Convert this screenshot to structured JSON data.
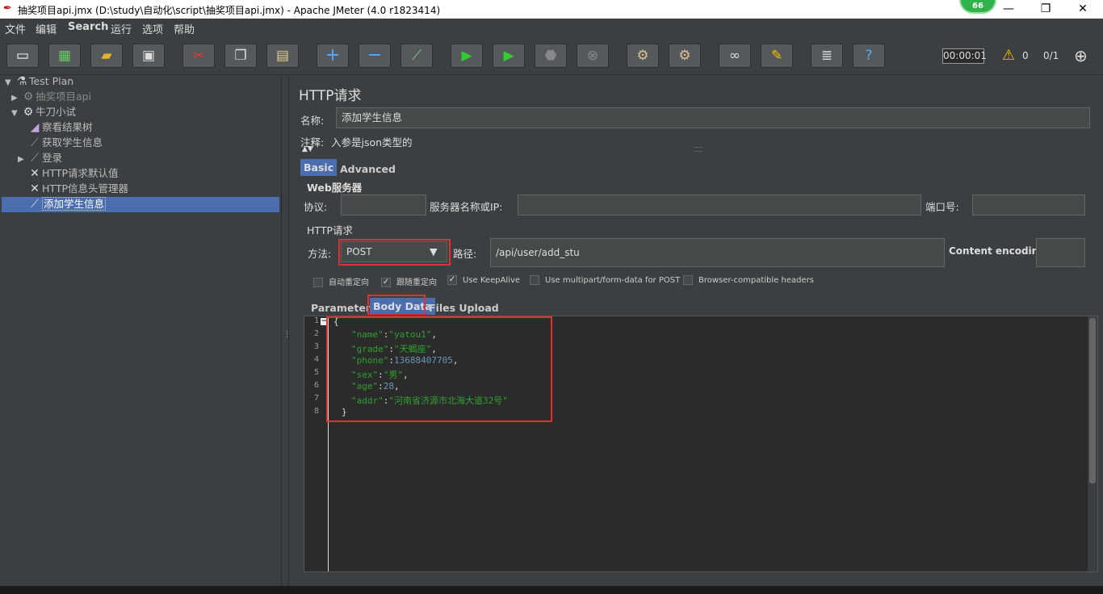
{
  "window": {
    "title": "抽奖项目api.jmx (D:\\study\\自动化\\script\\抽奖项目api.jmx) - Apache JMeter (4.0 r1823414)",
    "badge": "66"
  },
  "menu": [
    "文件",
    "编辑",
    "Search",
    "运行",
    "选项",
    "帮助"
  ],
  "toolbar": {
    "timer": "00:00:01",
    "warnings": "0",
    "threads": "0/1"
  },
  "tree": [
    {
      "label": "Test Plan",
      "exp": "▼",
      "icon": "flask-icon"
    },
    {
      "label": "抽奖项目api",
      "exp": "▶",
      "icon": "gear-icon"
    },
    {
      "label": "牛刀小试",
      "exp": "▼",
      "icon": "gear-icon"
    },
    {
      "label": "察看结果树",
      "exp": "",
      "icon": "chart-icon"
    },
    {
      "label": "获取学生信息",
      "exp": "",
      "icon": "pipette-icon"
    },
    {
      "label": "登录",
      "exp": "▶",
      "icon": "pipette-icon"
    },
    {
      "label": "HTTP请求默认值",
      "exp": "",
      "icon": "wrench-icon"
    },
    {
      "label": "HTTP信息头管理器",
      "exp": "",
      "icon": "wrench-icon"
    },
    {
      "label": "添加学生信息",
      "exp": "",
      "icon": "pipette-icon"
    }
  ],
  "form": {
    "heading": "HTTP请求",
    "name_label": "名称:",
    "name_value": "添加学生信息",
    "comment_label": "注释:",
    "comment_value": "入参是json类型的",
    "tabs": [
      "Basic",
      "Advanced"
    ],
    "web_server_legend": "Web服务器",
    "protocol_label": "协议:",
    "protocol_value": "",
    "server_label": "服务器名称或IP:",
    "server_value": "",
    "port_label": "端口号:",
    "port_value": "",
    "http_request_legend": "HTTP请求",
    "method_label": "方法:",
    "method_value": "POST",
    "path_label": "路径:",
    "path_value": "/api/user/add_stu",
    "encoding_label": "Content encoding:",
    "encoding_value": "",
    "checkboxes": [
      {
        "label": "自动重定向",
        "checked": false
      },
      {
        "label": "跟随重定向",
        "checked": true
      },
      {
        "label": "Use KeepAlive",
        "checked": true
      },
      {
        "label": "Use multipart/form-data for POST",
        "checked": false
      },
      {
        "label": "Browser-compatible headers",
        "checked": false
      }
    ],
    "body_tabs": [
      "Parameters",
      "Body Data",
      "Files Upload"
    ]
  },
  "body": {
    "line_numbers": [
      "1",
      "2",
      "3",
      "4",
      "5",
      "6",
      "7",
      "8"
    ],
    "open_brace": "{",
    "close_brace": "}",
    "fields": [
      {
        "key": "\"name\"",
        "value": "\"yatou1\"",
        "type": "s",
        "comma": ","
      },
      {
        "key": "\"grade\"",
        "value": "\"天蝎座\"",
        "type": "s",
        "comma": ","
      },
      {
        "key": "\"phone\"",
        "value": "13688407705",
        "type": "n",
        "comma": ","
      },
      {
        "key": "\"sex\"",
        "value": "\"男\"",
        "type": "s",
        "comma": ","
      },
      {
        "key": "\"age\"",
        "value": "28",
        "type": "n",
        "comma": ","
      },
      {
        "key": "\"addr\"",
        "value": "\"河南省济源市北海大道32号\"",
        "type": "s",
        "comma": ""
      }
    ]
  }
}
